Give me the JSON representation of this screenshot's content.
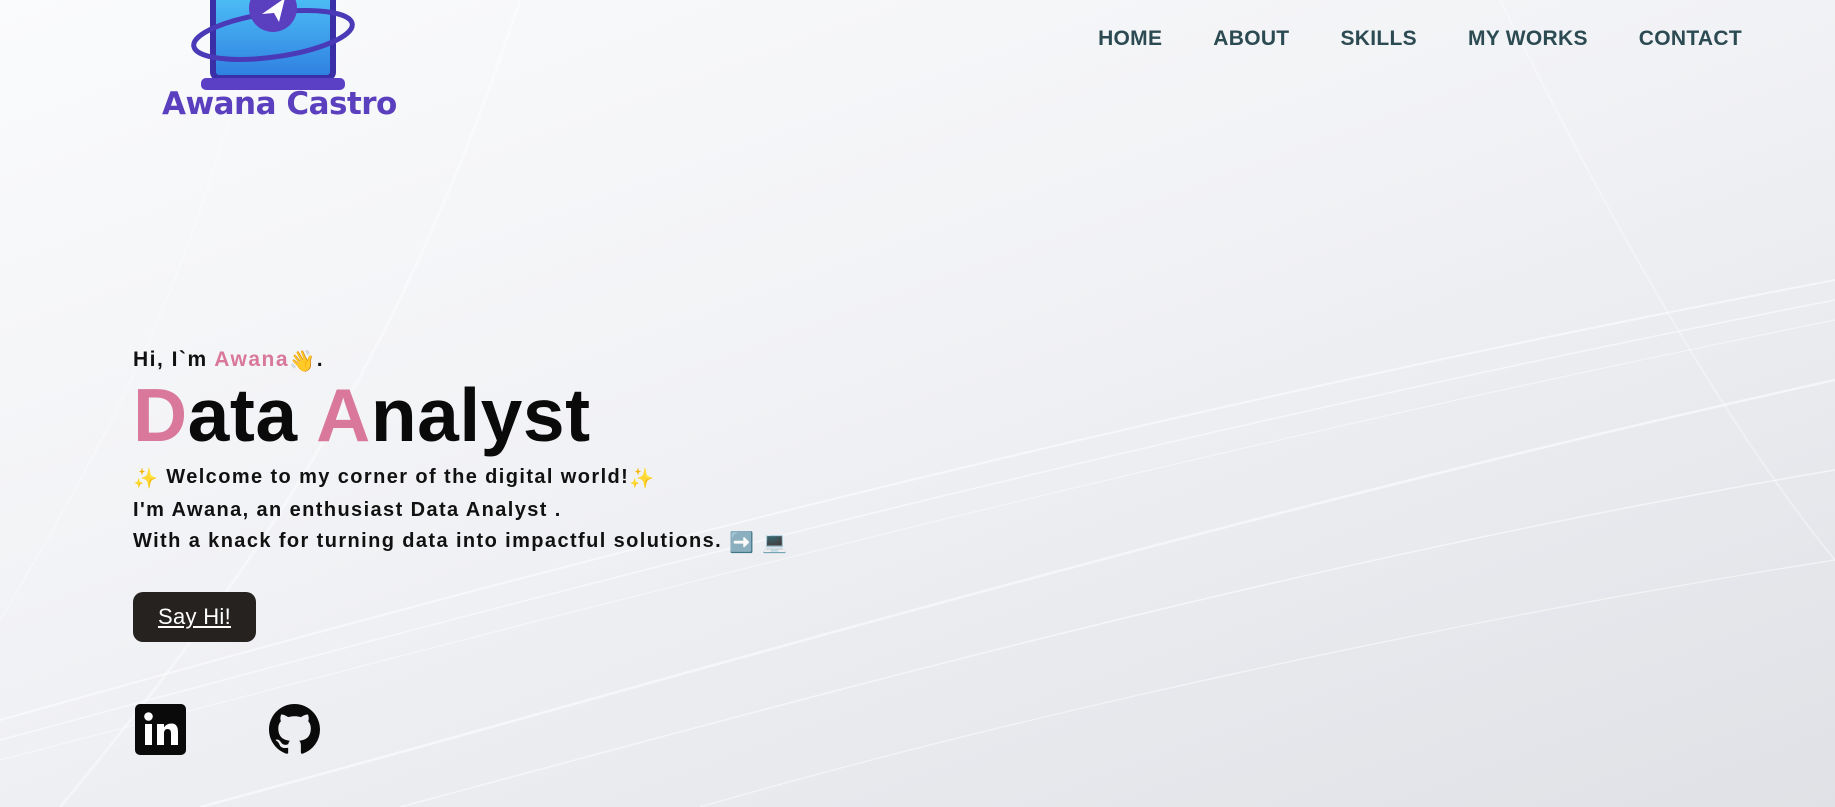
{
  "logo": {
    "name": "Awana Castro"
  },
  "nav": [
    "HOME",
    "ABOUT",
    "SKILLS",
    "MY WORKS",
    "CONTACT"
  ],
  "hero": {
    "greeting_prefix": "Hi, I`m ",
    "greeting_name": "Awana",
    "greeting_suffix": ".",
    "title_words": [
      {
        "initial": "D",
        "rest": "ata"
      },
      {
        "initial": "A",
        "rest": "nalyst"
      }
    ],
    "line1": "Welcome to my corner of the digital world!",
    "line2": "I'm Awana, an enthusiast Data Analyst .",
    "line3": "With a knack for turning data into impactful solutions.",
    "cta": "Say Hi!"
  },
  "socials": [
    {
      "icon": "linkedin-icon"
    },
    {
      "icon": "github-icon"
    }
  ],
  "colors": {
    "accent_pink": "#d9789a",
    "nav_text": "#2c4a52",
    "logo_purple": "#5a3fbe",
    "button_bg": "#252220"
  }
}
